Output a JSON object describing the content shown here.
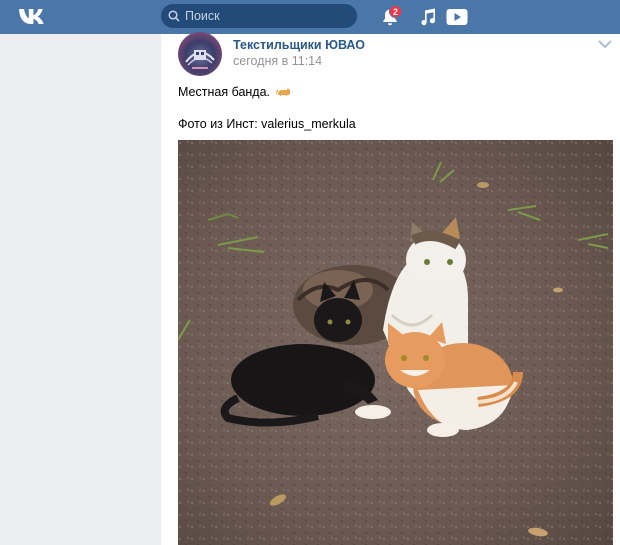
{
  "header": {
    "search_placeholder": "Поиск",
    "notifications_count": "2",
    "brand_color": "#4a76a8"
  },
  "post": {
    "author": "Текстильщики ЮВАО",
    "time": "сегодня в 11:14",
    "text_line1": "Местная банда.",
    "text_line2": "Фото из Инст: valerius_merkula"
  },
  "icons": [
    "vk-logo-icon",
    "search-icon",
    "bell-icon",
    "music-icon",
    "video-icon",
    "chevron-down-icon",
    "cat-emoji-icon"
  ]
}
